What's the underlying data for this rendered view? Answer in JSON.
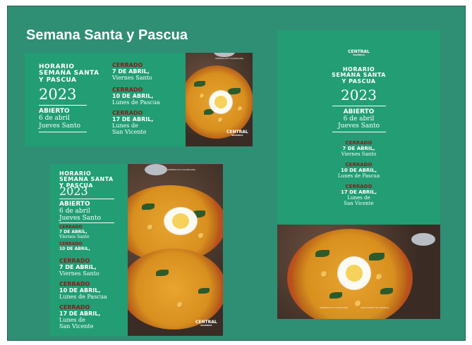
{
  "slide": {
    "title": "Semana Santa y Pascua"
  },
  "poster": {
    "horario_line1": "HORARIO",
    "horario_line2": "SEMANA SANTA",
    "horario_line3": "Y PASCUA",
    "year": "2023",
    "abierto": "ABIERTO",
    "abierto_date": "6 de abril",
    "abierto_day": "Jueves Santo",
    "cerrado": "CERRADO",
    "closed": [
      {
        "date": "7 DE ABRIL,",
        "day": "Viernes Santo"
      },
      {
        "date": "10 DE ABRIL,",
        "day": "Lunes de Pascua"
      },
      {
        "date": "17 DE ABRIL,",
        "day_line1": "Lunes de",
        "day_line2": "San Vicente"
      }
    ],
    "logo_main": "CENTRAL",
    "logo_sub": "VALÈNCIA",
    "sponsor1": "GENERALITAT VALENCIANA",
    "sponsor2": "AJUNTAMENT DE VALÈNCIA"
  },
  "colors": {
    "slide_bg": "#2f8f74",
    "poster_green": "#229d74",
    "closed_red": "#8b1a1a"
  }
}
